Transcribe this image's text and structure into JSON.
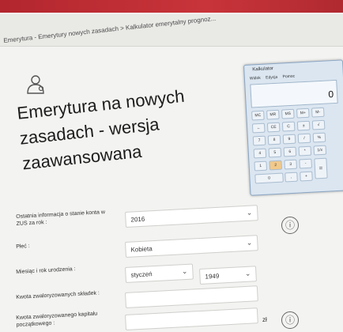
{
  "topbar": {
    "text": ""
  },
  "breadcrumb": {
    "text": "Emerytura - Emerytury nowych zasadach > Kalkulator emerytalny prognoz..."
  },
  "page": {
    "title_lines": [
      "Emerytura na nowych",
      "zasadach - wersja",
      "zaawansowana"
    ]
  },
  "form": {
    "account_info": {
      "label": "Ostatnia informacja o stanie konta w ZUS za rok :",
      "value": "2016"
    },
    "sex": {
      "label": "Płeć :",
      "value": "Kobieta"
    },
    "birth": {
      "label": "Miesiąc i rok urodzenia :",
      "month": "styczeń",
      "year": "1949"
    },
    "contributions": {
      "label": "Kwota zwaloryzowanych składek :"
    },
    "initial_capital": {
      "label": "Kwota zwaloryzowanego kapitału początkowego :",
      "unit": "zł"
    }
  },
  "calculator": {
    "title": "Kalkulator",
    "menu": [
      "Widok",
      "Edycja",
      "Pomoc"
    ],
    "display": "0",
    "keys_row1": [
      "MC",
      "MR",
      "MS",
      "M+",
      "M-"
    ],
    "keys_row2": [
      "←",
      "CE",
      "C",
      "±",
      "√"
    ],
    "keys_row3": [
      "7",
      "8",
      "9",
      "/",
      "%"
    ],
    "keys_row4": [
      "4",
      "5",
      "6",
      "*",
      "1/x"
    ],
    "keys_row5": [
      "1",
      "2",
      "3",
      "-"
    ],
    "keys_row6": [
      "0",
      ",",
      "+"
    ],
    "equals": "="
  },
  "icons": {
    "info": "ⓘ"
  }
}
